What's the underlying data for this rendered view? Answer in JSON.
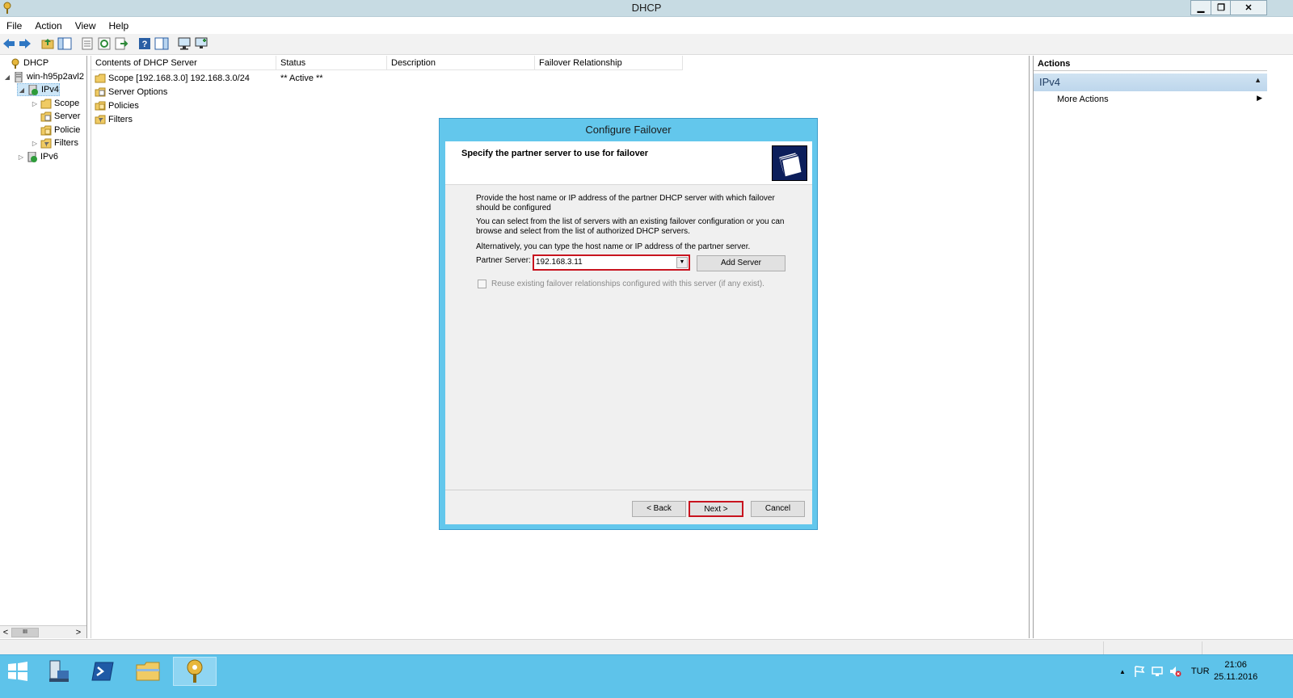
{
  "window": {
    "title": "DHCP",
    "minimize": "▁",
    "restore": "❐",
    "close": "✕"
  },
  "menu": [
    "File",
    "Action",
    "View",
    "Help"
  ],
  "toolbar_icons": [
    "back-arrow-icon",
    "forward-arrow-icon",
    "up-folder-icon",
    "show-hide-tree-icon",
    "properties-icon",
    "refresh-icon",
    "export-list-icon",
    "help-icon",
    "show-hide-action-pane-icon",
    "display-statistics-icon",
    "add-server-icon"
  ],
  "tree": {
    "root": "DHCP",
    "server": "win-h95p2avl2",
    "ipv4": "IPv4",
    "scope": "Scope",
    "server_options": "Server",
    "policies": "Policie",
    "filters": "Filters",
    "ipv6": "IPv6",
    "scroll_thumb": "III",
    "scroll_left": "<",
    "scroll_right": ">"
  },
  "list": {
    "columns": [
      "Contents of DHCP Server",
      "Status",
      "Description",
      "Failover Relationship"
    ],
    "rows": [
      {
        "name": "Scope [192.168.3.0] 192.168.3.0/24",
        "status": "** Active **"
      },
      {
        "name": "Server Options",
        "status": ""
      },
      {
        "name": "Policies",
        "status": ""
      },
      {
        "name": "Filters",
        "status": ""
      }
    ]
  },
  "actions": {
    "header": "Actions",
    "section": "IPv4",
    "items": [
      "More Actions"
    ]
  },
  "dialog": {
    "title": "Configure Failover",
    "heading": "Specify the partner server to use for failover",
    "para1": "Provide the host name or IP address of the partner DHCP server with which failover should be configured",
    "para2": "You can select from the list of servers with an existing failover configuration or you can browse and select from the list of authorized DHCP servers.",
    "para3": "Alternatively, you can type the host name or IP address of the partner server.",
    "partner_label": "Partner Server:",
    "partner_value": "192.168.3.11",
    "add_server": "Add Server",
    "reuse_label": "Reuse existing failover relationships configured with this server (if any exist).",
    "back": "< Back",
    "next": "Next >",
    "cancel": "Cancel"
  },
  "tray": {
    "language": "TUR",
    "time": "21:06",
    "date": "25.11.2016"
  },
  "taskbar_apps": [
    "start-icon",
    "server-manager-icon",
    "powershell-icon",
    "file-explorer-icon",
    "dhcp-icon"
  ],
  "colors": {
    "accent": "#5ec3ea",
    "highlight": "#c8141f",
    "dialog_frame": "#63c7ec"
  }
}
